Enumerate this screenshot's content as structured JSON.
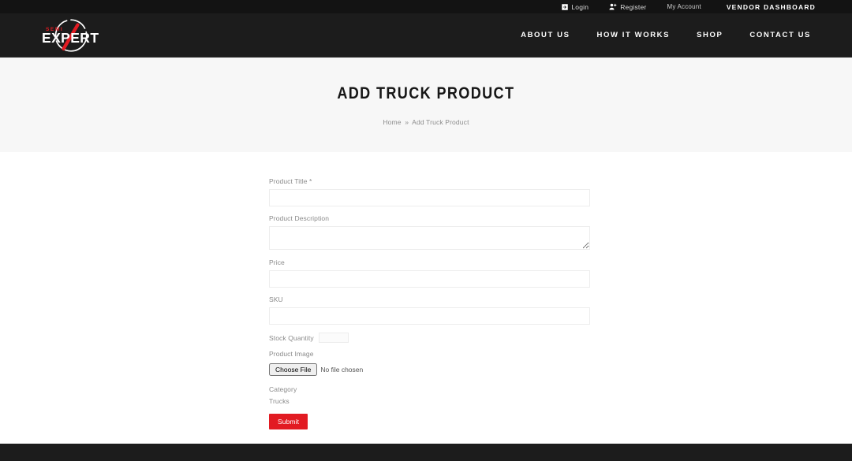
{
  "topbar": {
    "login": {
      "label": "Login",
      "icon": "sign-in-icon"
    },
    "register": {
      "label": "Register",
      "icon": "user-plus-icon"
    },
    "my_account": {
      "label": "My Account"
    },
    "vendor_dashboard": {
      "label": "VENDOR DASHBOARD"
    }
  },
  "brand": {
    "top_text": "SEMI",
    "main_text": "EXPERT",
    "accent_color": "#e21b22"
  },
  "nav": {
    "items": [
      {
        "label": "ABOUT US"
      },
      {
        "label": "HOW IT WORKS"
      },
      {
        "label": "SHOP"
      },
      {
        "label": "CONTACT US"
      }
    ]
  },
  "hero": {
    "title": "ADD TRUCK PRODUCT",
    "breadcrumb": {
      "home": "Home",
      "separator": "»",
      "current": "Add Truck Product"
    }
  },
  "form": {
    "product_title": {
      "label": "Product Title *",
      "value": "",
      "placeholder": ""
    },
    "product_description": {
      "label": "Product Description",
      "value": "",
      "placeholder": ""
    },
    "price": {
      "label": "Price",
      "value": "",
      "placeholder": ""
    },
    "sku": {
      "label": "SKU",
      "value": "",
      "placeholder": ""
    },
    "stock_quantity": {
      "label": "Stock Quantity",
      "value": "",
      "placeholder": ""
    },
    "product_image": {
      "label": "Product Image",
      "button_label": "Choose File",
      "status": "No file chosen"
    },
    "category": {
      "label": "Category",
      "value": "Trucks"
    },
    "submit": {
      "label": "Submit"
    }
  },
  "colors": {
    "header_bg": "#1c1c1c",
    "topbar_bg": "#131313",
    "hero_bg": "#f7f7f7",
    "accent_red": "#e21b22",
    "footer_bg": "#1c1c1c"
  }
}
